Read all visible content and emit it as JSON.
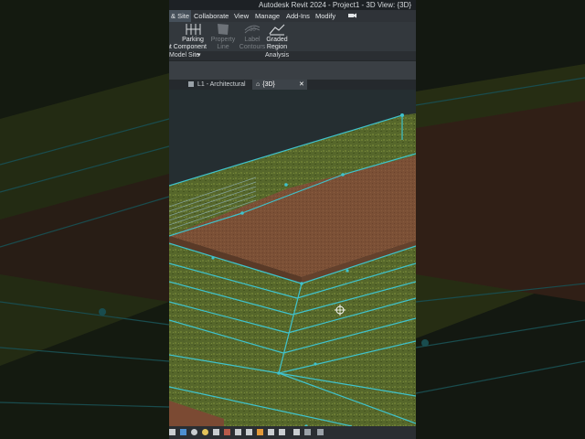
{
  "app": {
    "title": "Autodesk Revit 2024 - Project1 - 3D View: {3D}"
  },
  "menu": {
    "items": [
      {
        "id": "massing-site",
        "label": "& Site",
        "active": true
      },
      {
        "id": "collaborate",
        "label": "Collaborate",
        "active": false
      },
      {
        "id": "view",
        "label": "View",
        "active": false
      },
      {
        "id": "manage",
        "label": "Manage",
        "active": false
      },
      {
        "id": "add-ins",
        "label": "Add-Ins",
        "active": false
      },
      {
        "id": "modify",
        "label": "Modify",
        "active": false
      }
    ],
    "extra_icon": "video-camera-icon"
  },
  "ribbon": {
    "buttons": [
      {
        "id": "parking",
        "label1": "Parking",
        "label2": "nt Component",
        "enabled": true,
        "icon": "parking-icon"
      },
      {
        "id": "property-line",
        "label1": "Property",
        "label2": "Line",
        "enabled": false,
        "icon": "property-line-icon"
      },
      {
        "id": "label-contours",
        "label1": "Label",
        "label2": "Contours",
        "enabled": false,
        "icon": "label-contours-icon"
      },
      {
        "id": "graded-region",
        "label1": "Graded",
        "label2": "Region",
        "enabled": true,
        "icon": "graded-region-icon"
      }
    ],
    "panels": [
      {
        "id": "model-site",
        "label": "Model Site"
      },
      {
        "id": "analysis",
        "label": "Analysis"
      }
    ]
  },
  "tabs": [
    {
      "id": "l1",
      "label": "L1 - Architectural",
      "active": false,
      "icon": "floor-plan-icon"
    },
    {
      "id": "3d",
      "label": "{3D}",
      "active": true,
      "icon": "home-icon"
    }
  ],
  "colors": {
    "grass": "#55662a",
    "pad": "#7a4f35",
    "edges": "#3fc2cc"
  }
}
